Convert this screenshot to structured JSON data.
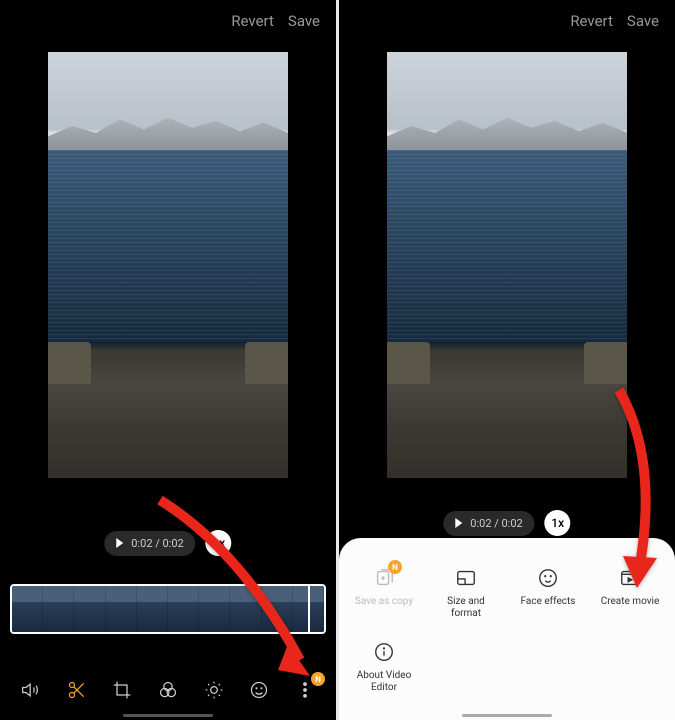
{
  "header": {
    "revert": "Revert",
    "save": "Save"
  },
  "playback": {
    "time": "0:02 / 0:02",
    "speed": "1x"
  },
  "toolbar": {
    "icons": [
      "volume",
      "trim",
      "crop",
      "filters",
      "brightness",
      "emoji",
      "more"
    ],
    "badge": "N"
  },
  "sheet": {
    "items": [
      {
        "key": "save_as_copy",
        "label": "Save as copy",
        "icon": "copy-plus",
        "disabled": true,
        "badge": "N"
      },
      {
        "key": "size_format",
        "label": "Size and format",
        "icon": "aspect",
        "disabled": false
      },
      {
        "key": "face_effects",
        "label": "Face effects",
        "icon": "face",
        "disabled": false
      },
      {
        "key": "create_movie",
        "label": "Create movie",
        "icon": "movie",
        "disabled": false
      },
      {
        "key": "about",
        "label": "About Video Editor",
        "icon": "info",
        "disabled": false
      }
    ]
  },
  "annotations": {
    "arrow_color": "#e8261c"
  }
}
